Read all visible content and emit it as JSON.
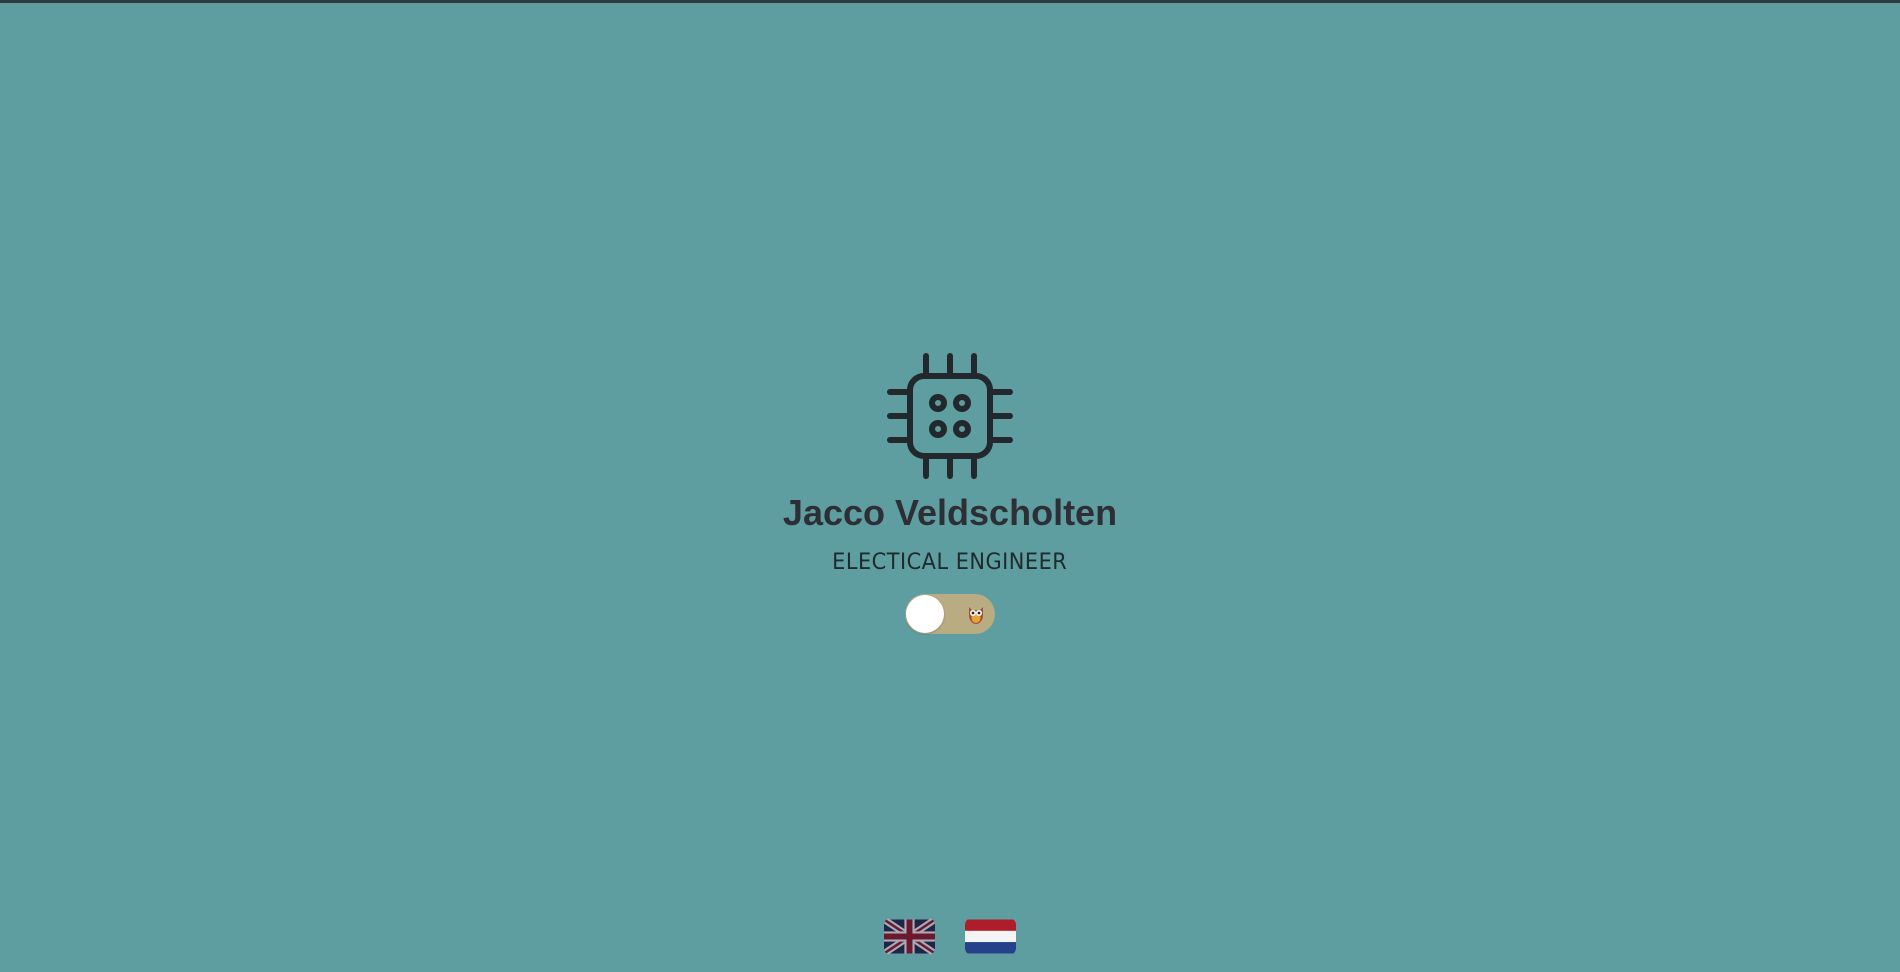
{
  "profile": {
    "name": "Jacco Veldscholten",
    "title": "ELECTICAL ENGINEER"
  },
  "icons": {
    "logo": "chip-icon",
    "toggle": "owl-icon",
    "lang_en": "uk-flag-icon",
    "lang_nl": "netherlands-flag-icon"
  },
  "colors": {
    "background": "#5f9ea0",
    "text": "#2e2f36",
    "toggle_track": "#b9ab82",
    "toggle_knob": "#ffffff"
  },
  "toggle": {
    "state": "off"
  }
}
